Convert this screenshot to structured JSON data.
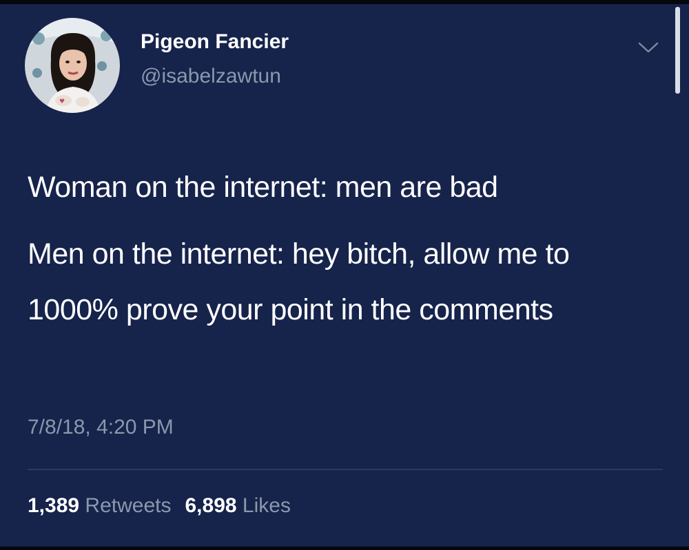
{
  "tweet": {
    "author": {
      "display_name": "Pigeon Fancier",
      "handle": "@isabelzawtun",
      "avatar_icon": "profile-photo"
    },
    "menu_icon": "chevron-down-icon",
    "text_lines": [
      "Woman on the internet: men are bad",
      "Men on the internet: hey bitch, allow me to 1000% prove your point in the comments"
    ],
    "timestamp": "7/8/18, 4:20 PM",
    "stats": {
      "retweets_count": "1,389",
      "retweets_label": "Retweets",
      "likes_count": "6,898",
      "likes_label": "Likes"
    }
  },
  "colors": {
    "background": "#16234b",
    "text_primary": "#ffffff",
    "text_secondary": "#8b98ad"
  }
}
